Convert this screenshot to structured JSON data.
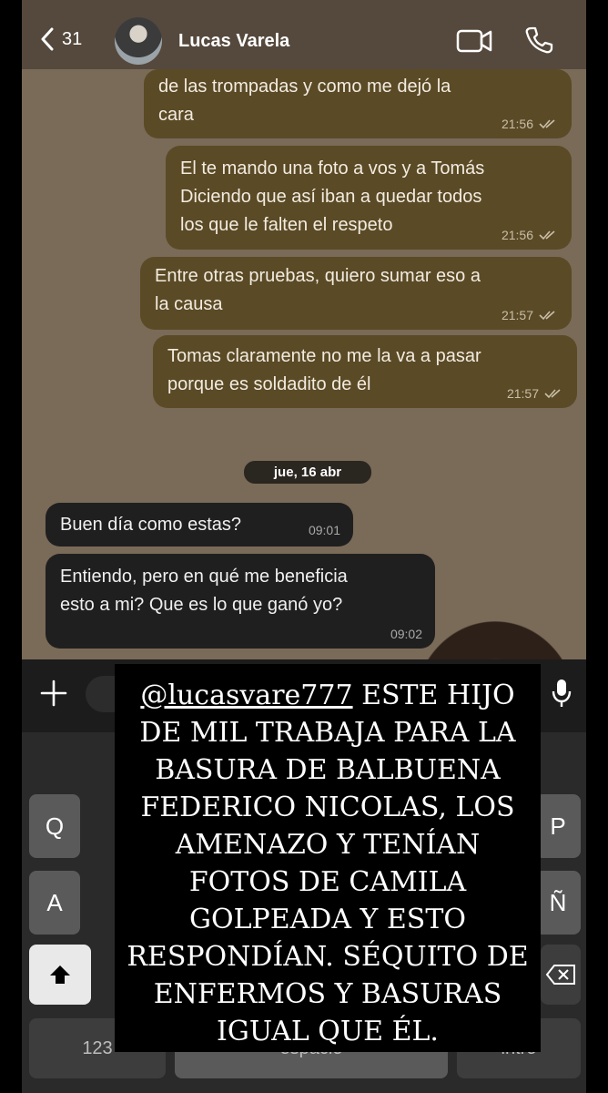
{
  "header": {
    "back_count": "31",
    "contact_name": "Lucas Varela",
    "icons": [
      "back-chevron-icon",
      "video-call-icon",
      "phone-call-icon"
    ]
  },
  "messages": [
    {
      "direction": "outgoing",
      "text": "de las trompadas y como me dejó la\ncara",
      "time": "21:56",
      "status": "read"
    },
    {
      "direction": "outgoing",
      "text": "El te mando una foto a vos y a Tomás\nDiciendo que así iban a quedar todos\nlos que le falten el respeto",
      "time": "21:56",
      "status": "read"
    },
    {
      "direction": "outgoing",
      "text": "Entre otras pruebas, quiero sumar eso a\nla causa",
      "time": "21:57",
      "status": "read"
    },
    {
      "direction": "outgoing",
      "text": "Tomas claramente no me la va a pasar\nporque es soldadito de él",
      "time": "21:57",
      "status": "read"
    }
  ],
  "date_separator": "jue, 16 abr",
  "incoming": [
    {
      "direction": "incoming",
      "text": "Buen día como estas?",
      "time": "09:01"
    },
    {
      "direction": "incoming",
      "text": "Entiendo, pero en qué me beneficia\nesto a mi? Que es lo que ganó yo?",
      "time": "09:02"
    }
  ],
  "keyboard": {
    "row_keys": [
      "Q",
      "P",
      "A",
      "Ñ"
    ],
    "bottom_left": "123",
    "bottom_middle": "espacio",
    "bottom_right": "intro"
  },
  "caption": {
    "mention": "@lucasvare777",
    "text": " ESTE HIJO DE MIL TRABAJA PARA LA BASURA DE BALBUENA FEDERICO NICOLAS, LOS AMENAZO Y TENÍAN FOTOS DE CAMILA GOLPEADA Y ESTO RESPONDÍAN. SÉQUITO DE ENFERMOS Y BASURAS IGUAL QUE ÉL."
  },
  "colors": {
    "chat_background": "#7a6a58",
    "outgoing_bubble": "#5a4a26",
    "incoming_bubble": "#1f1f1f"
  }
}
